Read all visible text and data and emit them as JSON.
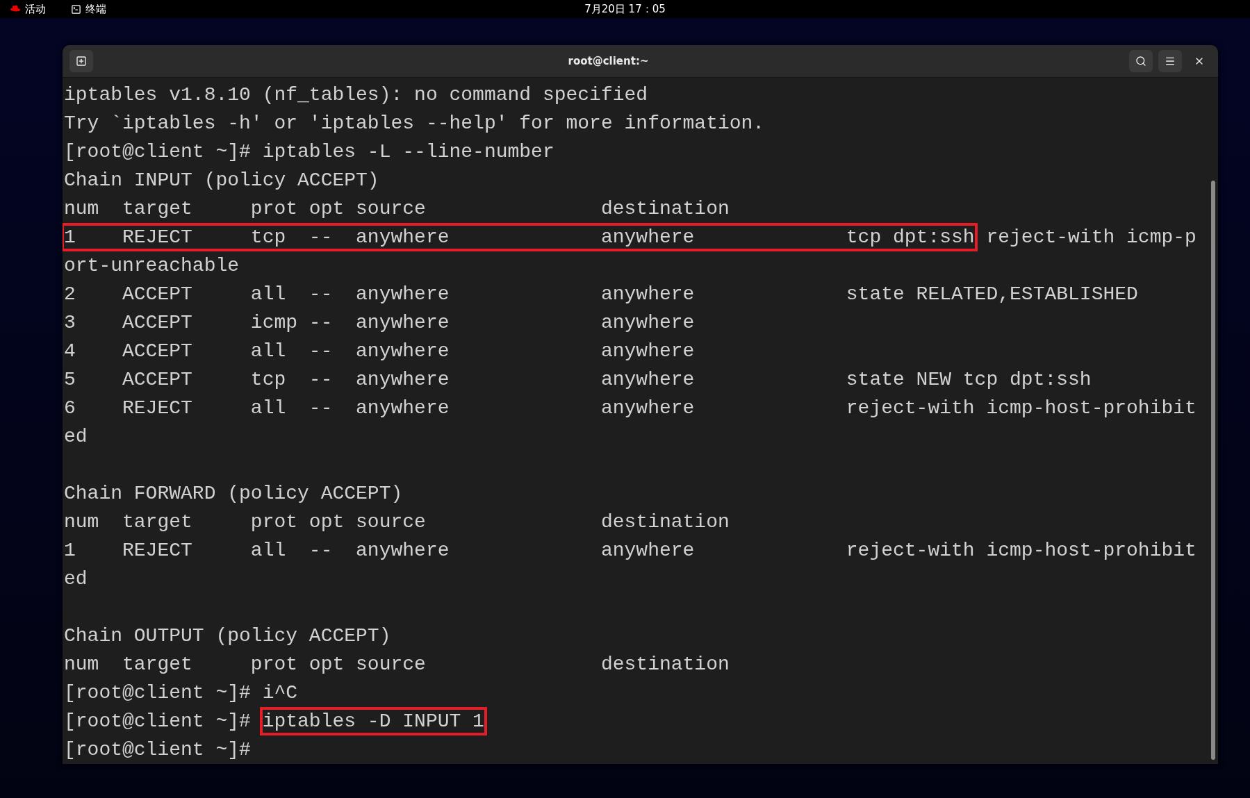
{
  "top_bar": {
    "activities": "活动",
    "app": "终端",
    "clock": "7月20日 17：05"
  },
  "window": {
    "title": "root@client:~"
  },
  "terminal": {
    "lines": [
      {
        "kind": "text",
        "segments": [
          {
            "text": "iptables v1.8.10 (nf_tables): no command specified",
            "highlighted": false
          }
        ]
      },
      {
        "kind": "text",
        "segments": [
          {
            "text": "Try `iptables -h' or 'iptables --help' for more information.",
            "highlighted": false
          }
        ]
      },
      {
        "kind": "text",
        "segments": [
          {
            "text": "[root@client ~]# iptables -L --line-number",
            "highlighted": false
          }
        ]
      },
      {
        "kind": "text",
        "segments": [
          {
            "text": "Chain INPUT (policy ACCEPT)",
            "highlighted": false
          }
        ]
      },
      {
        "kind": "text",
        "segments": [
          {
            "text": "num  target     prot opt source               destination",
            "highlighted": false
          }
        ]
      },
      {
        "kind": "text",
        "segments": [
          {
            "text": "1    REJECT     tcp  --  anywhere             anywhere             tcp dpt:ssh",
            "highlighted": true
          },
          {
            "text": "reject-with icmp-p",
            "highlighted": false
          }
        ]
      },
      {
        "kind": "text",
        "segments": [
          {
            "text": "ort-unreachable",
            "highlighted": false
          }
        ]
      },
      {
        "kind": "text",
        "segments": [
          {
            "text": "2    ACCEPT     all  --  anywhere             anywhere             state RELATED,ESTABLISHED",
            "highlighted": false
          }
        ]
      },
      {
        "kind": "text",
        "segments": [
          {
            "text": "3    ACCEPT     icmp --  anywhere             anywhere",
            "highlighted": false
          }
        ]
      },
      {
        "kind": "text",
        "segments": [
          {
            "text": "4    ACCEPT     all  --  anywhere             anywhere",
            "highlighted": false
          }
        ]
      },
      {
        "kind": "text",
        "segments": [
          {
            "text": "5    ACCEPT     tcp  --  anywhere             anywhere             state NEW tcp dpt:ssh",
            "highlighted": false
          }
        ]
      },
      {
        "kind": "text",
        "segments": [
          {
            "text": "6    REJECT     all  --  anywhere             anywhere             reject-with icmp-host-prohibit",
            "highlighted": false
          }
        ]
      },
      {
        "kind": "text",
        "segments": [
          {
            "text": "ed",
            "highlighted": false
          }
        ]
      },
      {
        "kind": "blank"
      },
      {
        "kind": "text",
        "segments": [
          {
            "text": "Chain FORWARD (policy ACCEPT)",
            "highlighted": false
          }
        ]
      },
      {
        "kind": "text",
        "segments": [
          {
            "text": "num  target     prot opt source               destination",
            "highlighted": false
          }
        ]
      },
      {
        "kind": "text",
        "segments": [
          {
            "text": "1    REJECT     all  --  anywhere             anywhere             reject-with icmp-host-prohibit",
            "highlighted": false
          }
        ]
      },
      {
        "kind": "text",
        "segments": [
          {
            "text": "ed",
            "highlighted": false
          }
        ]
      },
      {
        "kind": "blank"
      },
      {
        "kind": "text",
        "segments": [
          {
            "text": "Chain OUTPUT (policy ACCEPT)",
            "highlighted": false
          }
        ]
      },
      {
        "kind": "text",
        "segments": [
          {
            "text": "num  target     prot opt source               destination",
            "highlighted": false
          }
        ]
      },
      {
        "kind": "text",
        "segments": [
          {
            "text": "[root@client ~]# i^C",
            "highlighted": false
          }
        ]
      },
      {
        "kind": "text",
        "segments": [
          {
            "text": "[root@client ~]#",
            "highlighted": false
          },
          {
            "text": "iptables -D INPUT 1",
            "highlighted": true
          }
        ]
      },
      {
        "kind": "text",
        "segments": [
          {
            "text": "[root@client ~]#",
            "highlighted": false
          }
        ]
      }
    ]
  }
}
